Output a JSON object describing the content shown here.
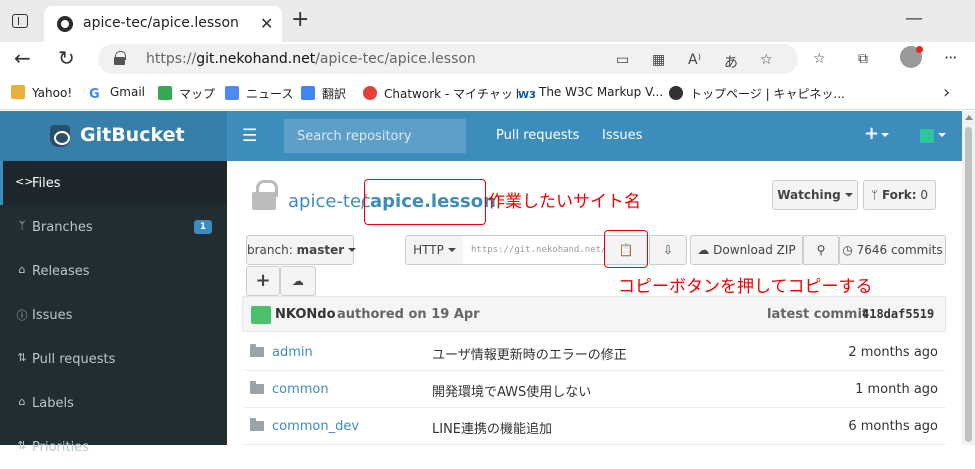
{
  "browser": {
    "tab_title": "apice-tec/apice.lesson",
    "tab_close": "✕",
    "new_tab": "+",
    "url_scheme": "https://",
    "url_host": "git.nekohand.net",
    "url_path": "/apice-tec/apice.lesson",
    "bookmarks": [
      {
        "label": "Yahoo!",
        "icon": "folder-icon",
        "color": "#e8b23a"
      },
      {
        "label": "Gmail",
        "icon": "google-icon",
        "color": "#4285f4"
      },
      {
        "label": "マップ",
        "icon": "maps-icon",
        "color": "#34a853"
      },
      {
        "label": "ニュース",
        "icon": "news-icon",
        "color": "#4c8bf5"
      },
      {
        "label": "翻訳",
        "icon": "translate-icon",
        "color": "#4285f4"
      },
      {
        "label": "Chatwork - マイチャット",
        "icon": "chatwork-icon",
        "color": "#e2403a"
      },
      {
        "label": "The W3C Markup V...",
        "icon": "w3c-icon",
        "color": "#005a9c"
      },
      {
        "label": "トップページ | キャピネッ...",
        "icon": "capinet-icon",
        "color": "#333333"
      }
    ]
  },
  "header": {
    "brand": "GitBucket",
    "search_placeholder": "Search repository",
    "links": [
      "Pull requests",
      "Issues"
    ],
    "plus": "+"
  },
  "sidebar": {
    "items": [
      {
        "label": "Files",
        "icon": "code-icon",
        "glyph": "<>",
        "active": true
      },
      {
        "label": "Branches",
        "icon": "branch-icon",
        "glyph": "ᛘ",
        "badge": "1"
      },
      {
        "label": "Releases",
        "icon": "tag-icon",
        "glyph": "⌂"
      },
      {
        "label": "Issues",
        "icon": "issue-icon",
        "glyph": "ⓘ"
      },
      {
        "label": "Pull requests",
        "icon": "pull-request-icon",
        "glyph": "⇅"
      },
      {
        "label": "Labels",
        "icon": "label-icon",
        "glyph": "⌂"
      },
      {
        "label": "Priorities",
        "icon": "priority-icon",
        "glyph": "⇅"
      }
    ]
  },
  "repo": {
    "owner": "apice-tec",
    "separator": "/",
    "name": "apice.lesson",
    "watch_label": "Watching",
    "fork_label": "Fork:",
    "fork_count": "0",
    "branch_prefix": "branch:",
    "branch": "master",
    "protocol": "HTTP",
    "clone_url": "https://git.nekohand.net/git/apice-tec/apice.lesson.git",
    "download_label": "Download ZIP",
    "commits_label": "7646 commits"
  },
  "annotations": {
    "site_name": "作業したいサイト名",
    "copy_hint": "コピーボタンを押してコピーする"
  },
  "latest_commit": {
    "author": "NKONdo",
    "meta": "authored on 19 Apr",
    "label": "latest commit",
    "hash": "418daf5519"
  },
  "files": [
    {
      "name": "admin",
      "message": "ユーザ情報更新時のエラーの修正",
      "age": "2 months ago"
    },
    {
      "name": "common",
      "message": "開発環境でAWS使用しない",
      "age": "1 month ago"
    },
    {
      "name": "common_dev",
      "message": "LINE連携の機能追加",
      "age": "6 months ago"
    }
  ],
  "colors": {
    "header_bg": "#3c8dbc",
    "sidebar_bg": "#222d32",
    "annotation_red": "#ee0000",
    "link_blue": "#3c8dbc"
  }
}
